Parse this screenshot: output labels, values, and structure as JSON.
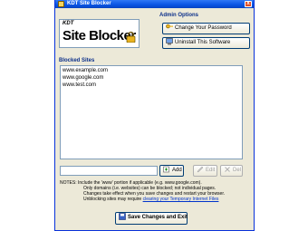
{
  "window": {
    "title": "KDT Site Blocker",
    "close_label": "x"
  },
  "logo": {
    "small_text": "KDT",
    "main_text": "Site Blocker"
  },
  "admin": {
    "title": "Admin Options",
    "change_password_label": "Change Your Password",
    "uninstall_label": "Uninstall This Software"
  },
  "blocked": {
    "section_label": "Blocked Sites",
    "sites": [
      "www.example.com",
      "www.google.com",
      "www.test.com"
    ]
  },
  "controls": {
    "add_input_value": "",
    "add_label": "Add",
    "edit_label": "Edit",
    "del_label": "Del"
  },
  "notes": {
    "line1": "NOTES: Include the 'www' portion if applicable (e.g. www.google.com).",
    "line2": "Only domains (i.e. websites) can be blocked; not individual pages.",
    "line3": "Changes take effect when you save changes and restart your browser.",
    "line4_prefix": "Unblocking sites may require ",
    "line4_link": "clearing your Temporary Internet Files"
  },
  "save_label": "Save Changes and Exit",
  "colors": {
    "accent": "#0b2f8a",
    "titlebar": "#0a54e3",
    "link": "#0033cc"
  }
}
